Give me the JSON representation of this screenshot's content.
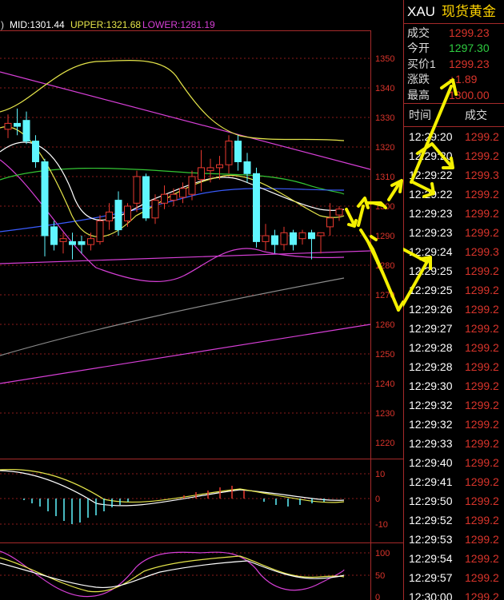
{
  "indicator_header": {
    "prefix": ")",
    "mid": "MID:1301.44",
    "upper": "UPPER:1321.68",
    "lower": "LOWER:1281.19"
  },
  "price_axis": [
    "1350",
    "1340",
    "1330",
    "1320",
    "1310",
    "1300",
    "1290",
    "1280",
    "1270",
    "1260",
    "1250",
    "1240",
    "1230",
    "1220"
  ],
  "macd_axis": [
    "10",
    "0",
    "-10"
  ],
  "kdj_axis": [
    "100",
    "50",
    "0"
  ],
  "quote": {
    "symbol": "XAU",
    "name": "现货黄金",
    "rows": [
      {
        "label": "成交",
        "value": "1299.23",
        "color": "#d9342b"
      },
      {
        "label": "今开",
        "value": "1297.30",
        "color": "#2ecc40"
      },
      {
        "label": "买价1",
        "value": "1299.23",
        "color": "#d9342b"
      },
      {
        "label": "涨跌",
        "value": "+1.89",
        "color": "#d9342b"
      },
      {
        "label": "最高",
        "value": "1300.00",
        "color": "#d9342b"
      }
    ]
  },
  "ticks_header": {
    "time": "时间",
    "price": "成交"
  },
  "ticks": [
    {
      "time": "12:29:20",
      "price": "1299.2"
    },
    {
      "time": "12:29:20",
      "price": "1299.2"
    },
    {
      "time": "12:29:22",
      "price": "1299.3"
    },
    {
      "time": "12:29:22",
      "price": "1299.2"
    },
    {
      "time": "12:29:23",
      "price": "1299.2"
    },
    {
      "time": "12:29:23",
      "price": "1299.2"
    },
    {
      "time": "12:29:24",
      "price": "1299.3"
    },
    {
      "time": "12:29:25",
      "price": "1299.2"
    },
    {
      "time": "12:29:25",
      "price": "1299.2"
    },
    {
      "time": "12:29:26",
      "price": "1299.2"
    },
    {
      "time": "12:29:27",
      "price": "1299.2"
    },
    {
      "time": "12:29:28",
      "price": "1299.2"
    },
    {
      "time": "12:29:28",
      "price": "1299.2"
    },
    {
      "time": "12:29:30",
      "price": "1299.2"
    },
    {
      "time": "12:29:32",
      "price": "1299.2"
    },
    {
      "time": "12:29:32",
      "price": "1299.2"
    },
    {
      "time": "12:29:33",
      "price": "1299.2"
    },
    {
      "time": "12:29:40",
      "price": "1299.2"
    },
    {
      "time": "12:29:41",
      "price": "1299.2"
    },
    {
      "time": "12:29:50",
      "price": "1299.2"
    },
    {
      "time": "12:29:52",
      "price": "1299.2"
    },
    {
      "time": "12:29:53",
      "price": "1299.2"
    },
    {
      "time": "12:29:54",
      "price": "1299.2"
    },
    {
      "time": "12:29:57",
      "price": "1299.2"
    },
    {
      "time": "12:30:00",
      "price": "1299.2"
    }
  ],
  "chart_data": {
    "type": "candlestick",
    "ylim": [
      1218,
      1357
    ],
    "candles": [
      {
        "o": 1326,
        "h": 1331,
        "l": 1323,
        "c": 1328
      },
      {
        "o": 1328,
        "h": 1333,
        "l": 1324,
        "c": 1327
      },
      {
        "o": 1329,
        "h": 1332,
        "l": 1321,
        "c": 1322
      },
      {
        "o": 1322,
        "h": 1324,
        "l": 1313,
        "c": 1315
      },
      {
        "o": 1315,
        "h": 1316,
        "l": 1283,
        "c": 1290
      },
      {
        "o": 1293,
        "h": 1295,
        "l": 1285,
        "c": 1287
      },
      {
        "o": 1288,
        "h": 1291,
        "l": 1284,
        "c": 1289
      },
      {
        "o": 1288,
        "h": 1291,
        "l": 1282,
        "c": 1287
      },
      {
        "o": 1288,
        "h": 1290,
        "l": 1284,
        "c": 1287
      },
      {
        "o": 1287,
        "h": 1291,
        "l": 1285,
        "c": 1289
      },
      {
        "o": 1288,
        "h": 1297,
        "l": 1287,
        "c": 1295
      },
      {
        "o": 1295,
        "h": 1301,
        "l": 1292,
        "c": 1298
      },
      {
        "o": 1302,
        "h": 1305,
        "l": 1290,
        "c": 1292
      },
      {
        "o": 1295,
        "h": 1301,
        "l": 1293,
        "c": 1300
      },
      {
        "o": 1301,
        "h": 1312,
        "l": 1298,
        "c": 1310
      },
      {
        "o": 1310,
        "h": 1311,
        "l": 1295,
        "c": 1296
      },
      {
        "o": 1296,
        "h": 1304,
        "l": 1294,
        "c": 1302
      },
      {
        "o": 1301,
        "h": 1307,
        "l": 1299,
        "c": 1304
      },
      {
        "o": 1302,
        "h": 1306,
        "l": 1300,
        "c": 1304
      },
      {
        "o": 1303,
        "h": 1308,
        "l": 1301,
        "c": 1306
      },
      {
        "o": 1304,
        "h": 1312,
        "l": 1302,
        "c": 1310
      },
      {
        "o": 1309,
        "h": 1319,
        "l": 1305,
        "c": 1313
      },
      {
        "o": 1312,
        "h": 1316,
        "l": 1308,
        "c": 1313
      },
      {
        "o": 1313,
        "h": 1317,
        "l": 1309,
        "c": 1314
      },
      {
        "o": 1314,
        "h": 1324,
        "l": 1311,
        "c": 1322
      },
      {
        "o": 1322,
        "h": 1324,
        "l": 1312,
        "c": 1315
      },
      {
        "o": 1315,
        "h": 1318,
        "l": 1308,
        "c": 1311
      },
      {
        "o": 1311,
        "h": 1313,
        "l": 1286,
        "c": 1288
      },
      {
        "o": 1288,
        "h": 1294,
        "l": 1285,
        "c": 1290
      },
      {
        "o": 1290,
        "h": 1292,
        "l": 1284,
        "c": 1287
      },
      {
        "o": 1287,
        "h": 1293,
        "l": 1285,
        "c": 1291
      },
      {
        "o": 1291,
        "h": 1292,
        "l": 1285,
        "c": 1287
      },
      {
        "o": 1289,
        "h": 1292,
        "l": 1287,
        "c": 1291
      },
      {
        "o": 1291,
        "h": 1292,
        "l": 1282,
        "c": 1289
      },
      {
        "o": 1290,
        "h": 1291,
        "l": 1284,
        "c": 1291
      },
      {
        "o": 1293,
        "h": 1301,
        "l": 1290,
        "c": 1296
      },
      {
        "o": 1297,
        "h": 1300,
        "l": 1295,
        "c": 1299
      }
    ],
    "bollinger": {
      "mid": 1301.44,
      "upper": 1321.68,
      "lower": 1281.19
    },
    "colors": {
      "up": "#e8392f",
      "down": "#5ff6ff",
      "mid": "#ffffff",
      "upper": "#e5e54a",
      "lower": "#d63fd6"
    }
  }
}
